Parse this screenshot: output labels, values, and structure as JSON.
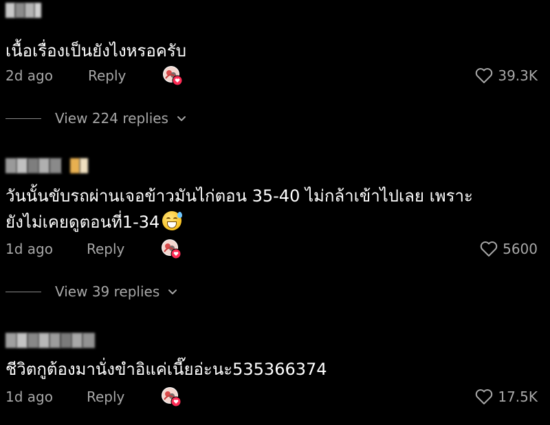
{
  "comments": [
    {
      "text_lines": [
        "เนื้อเรื่องเป็นยังไงหรอครับ"
      ],
      "date": "2d ago",
      "reply_label": "Reply",
      "likes": "39.3K",
      "view_replies": "View 224 replies"
    },
    {
      "text_lines": [
        "วันนั้นขับรถผ่านเจอข้าวมันไก่ตอน 35-40 ไม่กล้าเข้าไปเลย เพราะ",
        "ยังไม่เคยดูตอนที่1-34"
      ],
      "date": "1d ago",
      "reply_label": "Reply",
      "likes": "5600",
      "view_replies": "View 39 replies"
    },
    {
      "text_lines": [
        "ชีวิตกูต้องมานั่งขำอิแค่เนี๊ยอ่ะนะ535366374"
      ],
      "date": "1d ago",
      "reply_label": "Reply",
      "likes": "17.5K"
    }
  ],
  "icons": {
    "like": "heart-outline-icon",
    "expand": "chevron-down-icon",
    "creator_badge": "creator-liked-badge-icon",
    "emoji": "grinning-face-with-sweat-emoji"
  },
  "colors": {
    "background": "#000000",
    "text": "#ffffff",
    "muted": "#a8a8a8",
    "like_badge": "#fe2c55"
  }
}
